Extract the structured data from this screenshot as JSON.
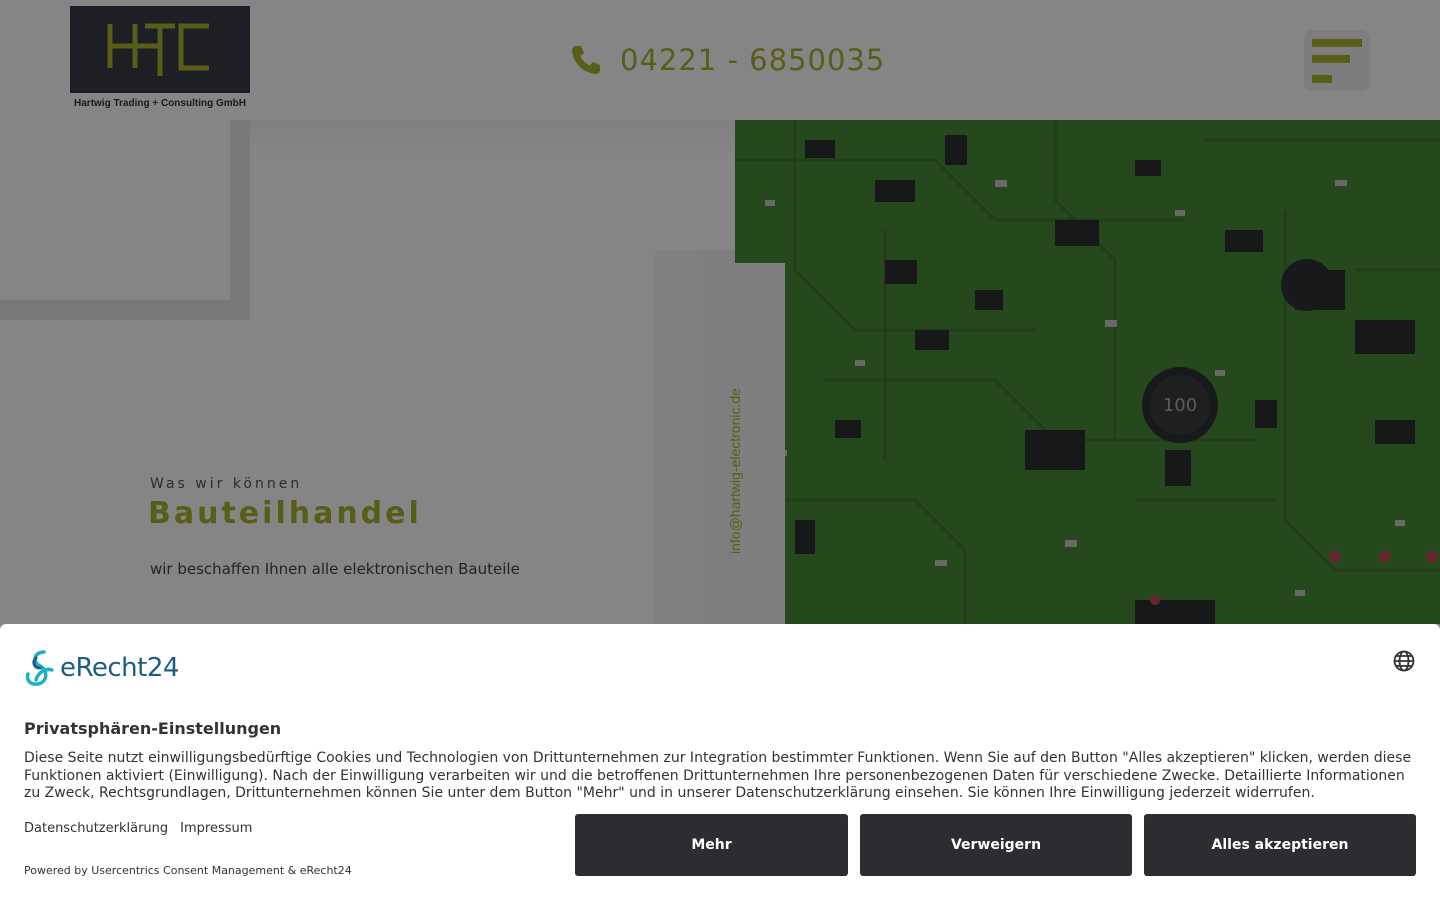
{
  "header": {
    "logo_letters": "HTC",
    "company_name": "Hartwig Trading + Consulting GmbH",
    "phone": "04221 - 6850035",
    "icons": [
      "phone-icon",
      "menu-icon"
    ]
  },
  "hero": {
    "eyebrow": "Was wir können",
    "headline": "Bauteilhandel",
    "subline": "wir beschaffen Ihnen alle elektronischen Bauteile",
    "email": "info@hartwig-electronic.de",
    "pcb_labels": [
      "100"
    ]
  },
  "consent": {
    "brand": "eRecht24",
    "title": "Privatsphären-Einstellungen",
    "text": "Diese Seite nutzt einwilligungsbedürftige Cookies und Technologien von Drittunternehmen zur Integration bestimmter Funktionen. Wenn Sie auf den Button \"Alles akzeptieren\" klicken, werden diese Funktionen aktiviert (Einwilligung). Nach der Einwilligung verarbeiten wir und die betroffenen Drittunternehmen Ihre personenbezogenen Daten für verschiedene Zwecke. Detaillierte Informationen zu Zweck, Rechtsgrundlagen, Drittunternehmen können Sie unter dem Button \"Mehr\" und in unserer Datenschutzerklärung einsehen. Sie können Ihre Einwilligung jederzeit widerrufen.",
    "links": {
      "privacy": "Datenschutzerklärung",
      "imprint": "Impressum"
    },
    "powered_by": "Powered by Usercentrics Consent Management & eRecht24",
    "buttons": {
      "more": "Mehr",
      "deny": "Verweigern",
      "accept_all": "Alles akzeptieren"
    },
    "icons": [
      "globe-icon",
      "erecht24-logo-icon"
    ]
  },
  "colors": {
    "accent": "#a9b52d",
    "logo_bg": "#3a3d45",
    "pcb_green": "#4e8a3a",
    "button_bg": "#2b2d30",
    "brand_blue": "#1a5e86"
  }
}
